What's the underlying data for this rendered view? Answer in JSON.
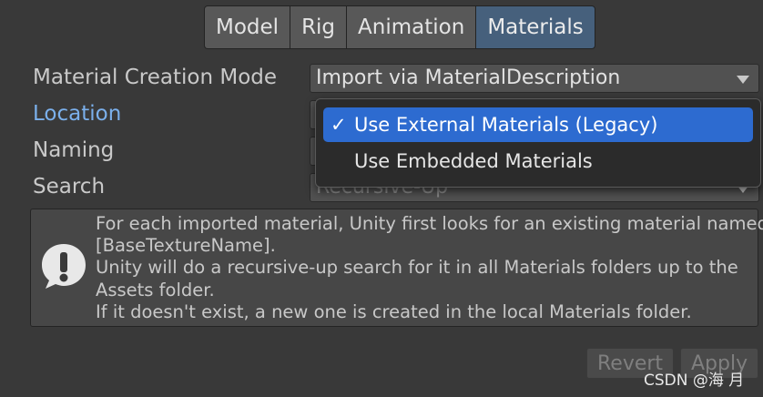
{
  "tabs": [
    {
      "label": "Model"
    },
    {
      "label": "Rig"
    },
    {
      "label": "Animation"
    },
    {
      "label": "Materials"
    }
  ],
  "fields": {
    "material_creation_mode": {
      "label": "Material Creation Mode",
      "value": "Import via MaterialDescription"
    },
    "location": {
      "label": "Location"
    },
    "naming": {
      "label": "Naming"
    },
    "search": {
      "label": "Search",
      "value": "Recursive-Up"
    }
  },
  "location_popup": {
    "options": [
      {
        "label": "Use External Materials (Legacy)",
        "checked": true,
        "check_glyph": "✓"
      },
      {
        "label": "Use Embedded Materials",
        "checked": false,
        "check_glyph": ""
      }
    ]
  },
  "help": {
    "icon": "exclamation-bubble-icon",
    "lines": [
      "For each imported material, Unity first looks for an existing material named",
      "[BaseTextureName].",
      "Unity will do a recursive-up search for it in all Materials folders up to the",
      "Assets folder.",
      "If it doesn't exist, a new one is created in the local Materials folder."
    ]
  },
  "buttons": {
    "revert": "Revert",
    "apply": "Apply"
  },
  "watermark": "CSDN @海 月",
  "colors": {
    "background": "#393939",
    "active_tab": "#46607c",
    "highlight_label": "#7bb0ec",
    "selection": "#2d6bd0"
  }
}
